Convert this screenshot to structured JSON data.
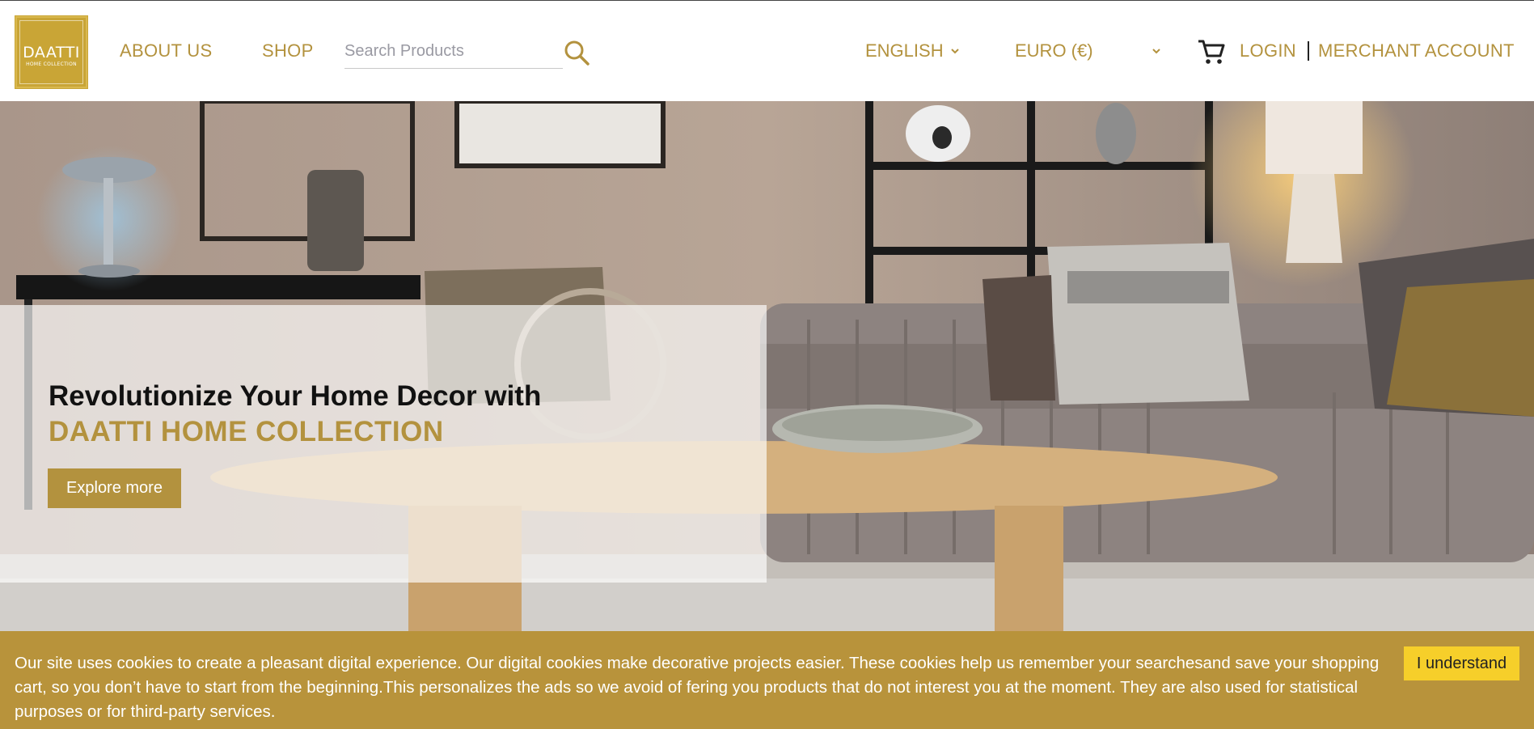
{
  "logo": {
    "title": "DAATTI",
    "subtitle": "HOME COLLECTION"
  },
  "nav": {
    "about": "ABOUT US",
    "shop": "SHOP"
  },
  "search": {
    "placeholder": "Search Products",
    "icon": "search-icon"
  },
  "language": {
    "selected": "ENGLISH"
  },
  "currency": {
    "selected": "EURO (€)"
  },
  "account": {
    "login": "LOGIN",
    "merchant": "MERCHANT ACCOUNT",
    "cart_icon": "shopping-cart-icon"
  },
  "hero": {
    "line1": "Revolutionize Your Home Decor with",
    "line2": "DAATTI HOME COLLECTION",
    "cta": "Explore more"
  },
  "cookie": {
    "text": "Our site uses cookies to create a pleasant digital experience. Our digital cookies make decorative projects easier. These cookies help us remember your searchesand save your shopping cart, so you don’t have to start from the beginning.This personalizes the ads so we avoid of fering you products that do not interest you at the moment. They are also used for statistical purposes or for third-party services.",
    "button": "I understand"
  },
  "colors": {
    "brand_gold": "#b3923e",
    "banner": "#b8933b",
    "accept_button": "#f6cf2a"
  }
}
